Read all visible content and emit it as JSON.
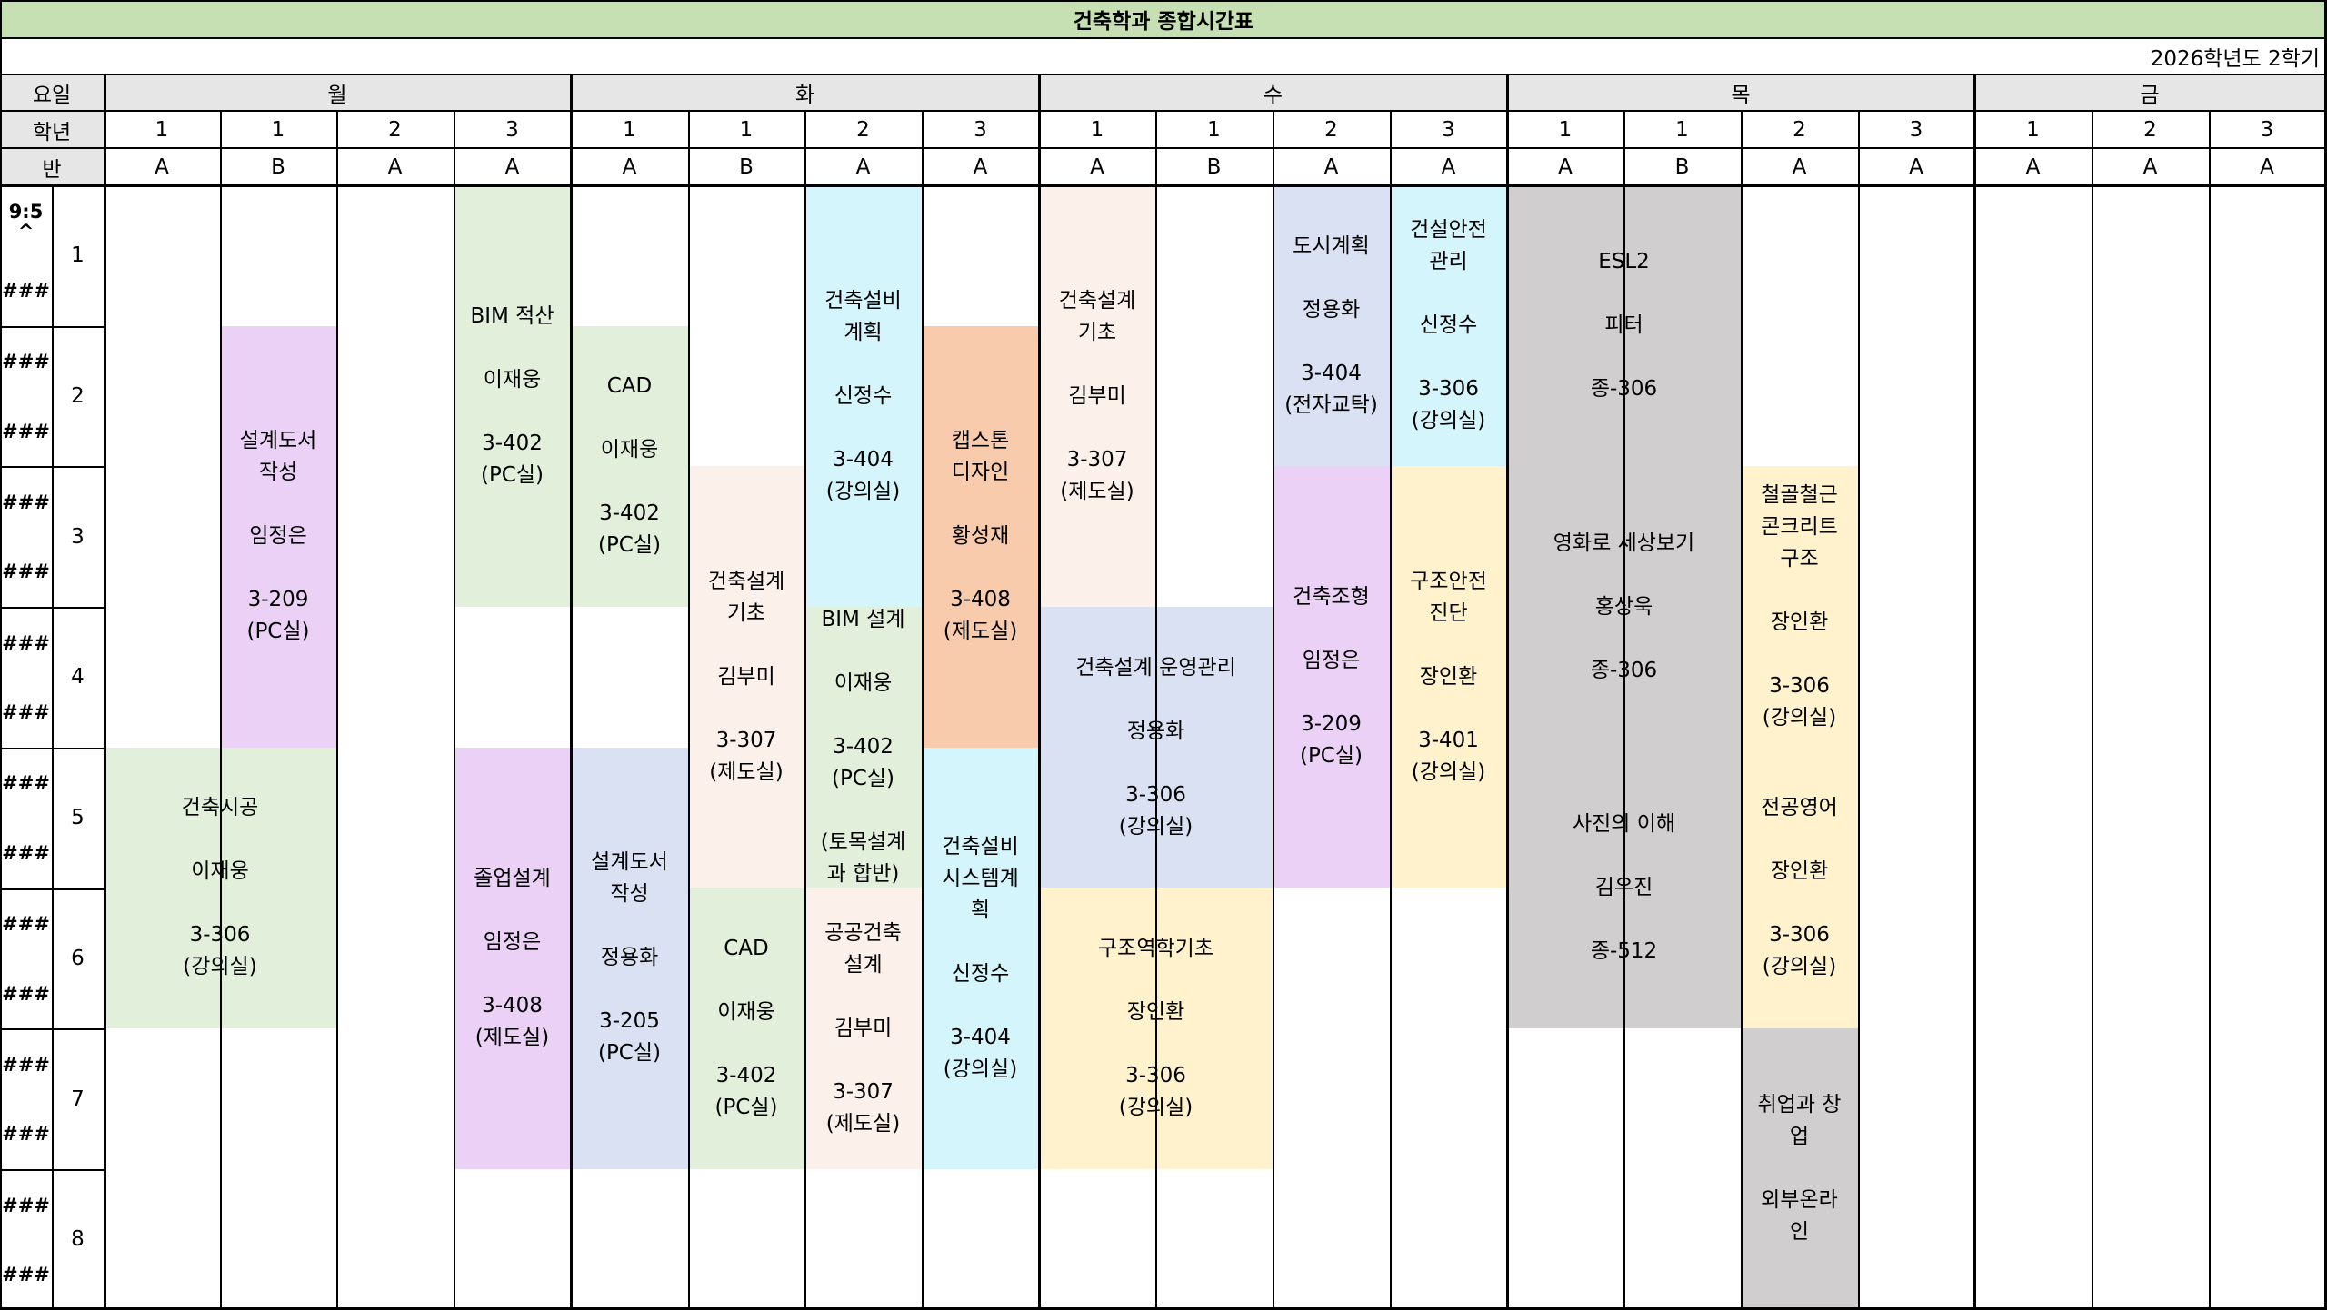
{
  "title": "건축학과  종합시간표",
  "semester": "2026학년도 2학기",
  "row_labels": {
    "day": "요일",
    "grade": "학년",
    "class": "반"
  },
  "days": [
    "월",
    "화",
    "수",
    "목",
    "금"
  ],
  "columns": [
    {
      "grade": "1",
      "class": "A"
    },
    {
      "grade": "1",
      "class": "B"
    },
    {
      "grade": "2",
      "class": "A"
    },
    {
      "grade": "3",
      "class": "A"
    },
    {
      "grade": "1",
      "class": "A"
    },
    {
      "grade": "1",
      "class": "B"
    },
    {
      "grade": "2",
      "class": "A"
    },
    {
      "grade": "3",
      "class": "A"
    },
    {
      "grade": "1",
      "class": "A"
    },
    {
      "grade": "1",
      "class": "B"
    },
    {
      "grade": "2",
      "class": "A"
    },
    {
      "grade": "3",
      "class": "A"
    },
    {
      "grade": "1",
      "class": "A"
    },
    {
      "grade": "1",
      "class": "B"
    },
    {
      "grade": "2",
      "class": "A"
    },
    {
      "grade": "3",
      "class": "A"
    },
    {
      "grade": "1",
      "class": "A"
    },
    {
      "grade": "2",
      "class": "A"
    },
    {
      "grade": "3",
      "class": "A"
    }
  ],
  "periods": [
    {
      "num": "1",
      "start": "9:5\n^",
      "end": "###"
    },
    {
      "num": "2",
      "start": "###",
      "end": "###"
    },
    {
      "num": "3",
      "start": "###",
      "end": "###"
    },
    {
      "num": "4",
      "start": "###",
      "end": "###"
    },
    {
      "num": "5",
      "start": "###",
      "end": "###"
    },
    {
      "num": "6",
      "start": "###",
      "end": "###"
    },
    {
      "num": "7",
      "start": "###",
      "end": "###"
    },
    {
      "num": "8",
      "start": "###",
      "end": "###"
    }
  ],
  "colors": {
    "title_bg": "#c6e0b4",
    "header_bg": "#e7e6e6",
    "green": "#e2efda",
    "purple": "#ead1f5",
    "cyan": "#d4f5fb",
    "orange": "#f8cbad",
    "peach": "#fcf0eb",
    "blue": "#d9e1f2",
    "yellow": "#fff2cc",
    "gray": "#d0cece"
  },
  "courses": [
    {
      "text": "건축시공\n\n이재웅\n\n3-306\n(강의실)",
      "col": 0,
      "span": 2,
      "start": 5,
      "len": 2,
      "color": "green"
    },
    {
      "text": "설계도서\n작성\n\n임정은\n\n3-209\n(PC실)",
      "col": 1,
      "span": 1,
      "start": 2,
      "len": 3,
      "color": "purple"
    },
    {
      "text": "BIM 적산\n\n이재웅\n\n3-402\n(PC실)",
      "col": 3,
      "span": 1,
      "start": 1,
      "len": 3,
      "color": "green"
    },
    {
      "text": "졸업설계\n\n임정은\n\n3-408\n(제도실)",
      "col": 3,
      "span": 1,
      "start": 5,
      "len": 3,
      "color": "purple"
    },
    {
      "text": "CAD\n\n이재웅\n\n3-402\n(PC실)",
      "col": 4,
      "span": 1,
      "start": 2,
      "len": 2,
      "color": "green"
    },
    {
      "text": "설계도서\n작성\n\n정용화\n\n3-205\n(PC실)",
      "col": 4,
      "span": 1,
      "start": 5,
      "len": 3,
      "color": "blue"
    },
    {
      "text": "건축설계\n기초\n\n김부미\n\n3-307\n(제도실)",
      "col": 5,
      "span": 1,
      "start": 3,
      "len": 3,
      "color": "peach"
    },
    {
      "text": "CAD\n\n이재웅\n\n3-402\n(PC실)",
      "col": 5,
      "span": 1,
      "start": 6,
      "len": 2,
      "color": "green"
    },
    {
      "text": "건축설비\n계획\n\n신정수\n\n3-404\n(강의실)",
      "col": 6,
      "span": 1,
      "start": 1,
      "len": 3,
      "color": "cyan"
    },
    {
      "text": "BIM 설계\n\n이재웅\n\n3-402\n(PC실)\n\n(토목설계\n과 합반)",
      "col": 6,
      "span": 1,
      "start": 4,
      "len": 2,
      "color": "green"
    },
    {
      "text": "공공건축\n설계\n\n김부미\n\n3-307\n(제도실)",
      "col": 6,
      "span": 1,
      "start": 6,
      "len": 2,
      "color": "peach"
    },
    {
      "text": "캡스톤\n디자인\n\n황성재\n\n3-408\n(제도실)",
      "col": 7,
      "span": 1,
      "start": 2,
      "len": 3,
      "color": "orange"
    },
    {
      "text": "건축설비\n시스템계\n획\n\n신정수\n\n3-404\n(강의실)",
      "col": 7,
      "span": 1,
      "start": 5,
      "len": 3,
      "color": "cyan"
    },
    {
      "text": "건축설계\n기초\n\n김부미\n\n3-307\n(제도실)",
      "col": 8,
      "span": 1,
      "start": 1,
      "len": 3,
      "color": "peach"
    },
    {
      "text": "건축설계 운영관리\n\n정용화\n\n3-306\n(강의실)",
      "col": 8,
      "span": 2,
      "start": 4,
      "len": 2,
      "color": "blue"
    },
    {
      "text": "구조역학기초\n\n장인환\n\n3-306\n(강의실)",
      "col": 8,
      "span": 2,
      "start": 6,
      "len": 2,
      "color": "yellow"
    },
    {
      "text": "도시계획\n\n정용화\n\n3-404\n(전자교탁)",
      "col": 10,
      "span": 1,
      "start": 1,
      "len": 2,
      "color": "blue"
    },
    {
      "text": "건축조형\n\n임정은\n\n3-209\n(PC실)",
      "col": 10,
      "span": 1,
      "start": 3,
      "len": 3,
      "color": "purple"
    },
    {
      "text": "건설안전\n관리\n\n신정수\n\n3-306\n(강의실)",
      "col": 11,
      "span": 1,
      "start": 1,
      "len": 2,
      "color": "cyan"
    },
    {
      "text": "구조안전\n진단\n\n장인환\n\n3-401\n(강의실)",
      "col": 11,
      "span": 1,
      "start": 3,
      "len": 3,
      "color": "yellow"
    },
    {
      "text": "ESL2\n\n피터\n\n종-306",
      "col": 12,
      "span": 2,
      "start": 1,
      "len": 2,
      "color": "gray"
    },
    {
      "text": "영화로 세상보기\n\n홍상욱\n\n종-306",
      "col": 12,
      "span": 2,
      "start": 3,
      "len": 2,
      "color": "gray"
    },
    {
      "text": "사진의 이해\n\n김우진\n\n종-512",
      "col": 12,
      "span": 2,
      "start": 5,
      "len": 2,
      "color": "gray"
    },
    {
      "text": "철골철근\n콘크리트\n구조\n\n장인환\n\n3-306\n(강의실)",
      "col": 14,
      "span": 1,
      "start": 3,
      "len": 2,
      "color": "yellow"
    },
    {
      "text": "전공영어\n\n장인환\n\n3-306\n(강의실)",
      "col": 14,
      "span": 1,
      "start": 5,
      "len": 2,
      "color": "yellow"
    },
    {
      "text": "취업과 창\n업\n\n외부온라\n인",
      "col": 14,
      "span": 1,
      "start": 7,
      "len": 2,
      "color": "gray"
    }
  ]
}
